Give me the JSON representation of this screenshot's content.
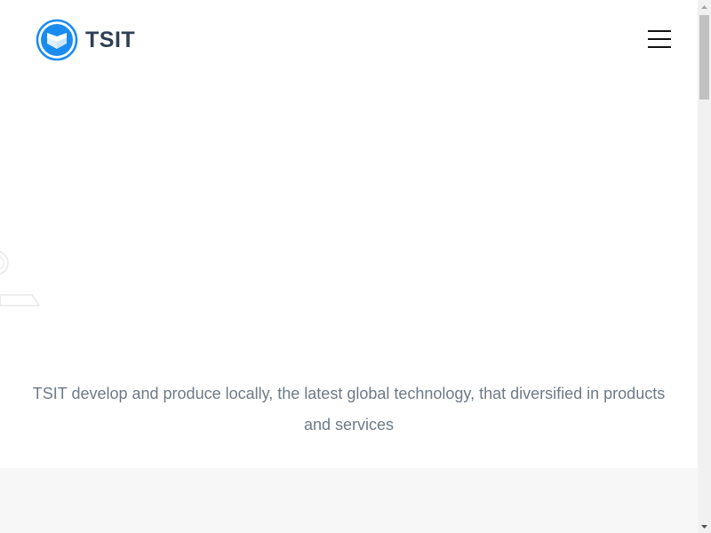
{
  "header": {
    "brand_name": "TSIT",
    "logo_icon": "shield-chevron-logo",
    "menu_icon": "hamburger-menu-icon"
  },
  "hero": {
    "tagline": "TSIT develop and produce locally, the latest global technology, that diversified in products and services"
  },
  "colors": {
    "brand_blue": "#1a8cf0",
    "brand_text": "#2f4055",
    "tagline_text": "#6f7a87",
    "section_bg": "#f7f7f7"
  }
}
